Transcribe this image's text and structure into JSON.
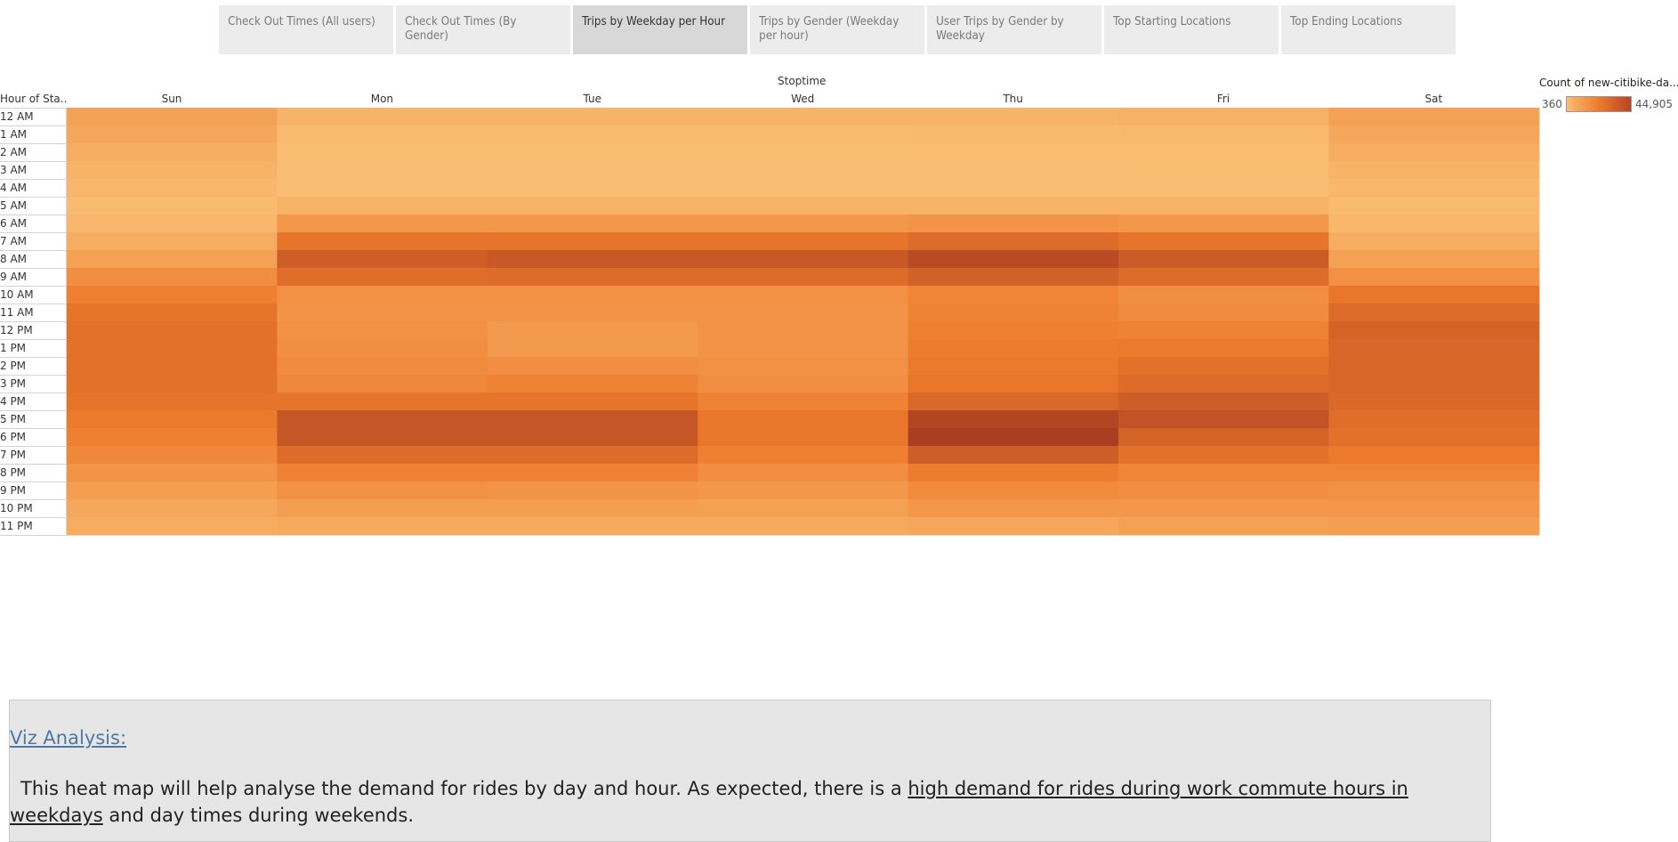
{
  "tabs": [
    {
      "label": "Check Out Times (All users)",
      "active": false
    },
    {
      "label": "Check Out Times (By Gender)",
      "active": false
    },
    {
      "label": "Trips by Weekday per Hour",
      "active": true
    },
    {
      "label": "Trips by Gender (Weekday per hour)",
      "active": false
    },
    {
      "label": "User Trips by Gender by Weekday",
      "active": false
    },
    {
      "label": "Top Starting Locations",
      "active": false
    },
    {
      "label": "Top Ending Locations",
      "active": false
    }
  ],
  "chart_data": {
    "type": "heatmap",
    "column_title": "Stoptime",
    "row_title": "Hour of Sta..",
    "columns": [
      "Sun",
      "Mon",
      "Tue",
      "Wed",
      "Thu",
      "Fri",
      "Sat"
    ],
    "rows": [
      "12 AM",
      "1 AM",
      "2 AM",
      "3 AM",
      "4 AM",
      "5 AM",
      "6 AM",
      "7 AM",
      "8 AM",
      "9 AM",
      "10 AM",
      "11 AM",
      "12 PM",
      "1 PM",
      "2 PM",
      "3 PM",
      "4 PM",
      "5 PM",
      "6 PM",
      "7 PM",
      "8 PM",
      "9 PM",
      "10 PM",
      "11 PM"
    ],
    "values": [
      [
        9500,
        3500,
        3500,
        3500,
        4000,
        4500,
        10000
      ],
      [
        7500,
        1500,
        1500,
        1500,
        1800,
        2000,
        7500
      ],
      [
        5500,
        800,
        800,
        800,
        900,
        1000,
        6000
      ],
      [
        4000,
        500,
        500,
        500,
        500,
        600,
        4000
      ],
      [
        2500,
        400,
        400,
        400,
        400,
        400,
        2500
      ],
      [
        1500,
        3500,
        3500,
        3500,
        3500,
        3500,
        1500
      ],
      [
        2500,
        13000,
        13000,
        13000,
        14000,
        13000,
        2800
      ],
      [
        6000,
        25000,
        25000,
        25000,
        28000,
        25000,
        6000
      ],
      [
        10000,
        33000,
        35000,
        35000,
        40000,
        34000,
        10000
      ],
      [
        16000,
        27000,
        28000,
        28000,
        32000,
        28000,
        15000
      ],
      [
        21000,
        15000,
        15000,
        15000,
        19000,
        16000,
        24000
      ],
      [
        25000,
        14000,
        14000,
        14000,
        20000,
        17000,
        28000
      ],
      [
        26000,
        15000,
        12000,
        14000,
        21000,
        20000,
        31000
      ],
      [
        26000,
        16000,
        12000,
        14000,
        22000,
        23000,
        30000
      ],
      [
        26000,
        17000,
        16000,
        15000,
        23000,
        26000,
        30000
      ],
      [
        26000,
        18000,
        20000,
        16000,
        24000,
        28000,
        30000
      ],
      [
        25000,
        25000,
        25000,
        20000,
        29000,
        33000,
        29000
      ],
      [
        23000,
        36000,
        36000,
        24000,
        42000,
        37000,
        27000
      ],
      [
        21000,
        36000,
        36000,
        24000,
        44905,
        31000,
        26000
      ],
      [
        18000,
        28000,
        28000,
        21000,
        33000,
        26000,
        23000
      ],
      [
        14000,
        20000,
        20000,
        16000,
        22000,
        19000,
        19000
      ],
      [
        11000,
        15000,
        14000,
        13000,
        17000,
        16000,
        15000
      ],
      [
        8000,
        11000,
        11000,
        10000,
        13000,
        13000,
        13000
      ],
      [
        6000,
        7000,
        7000,
        7000,
        8000,
        10000,
        11000
      ]
    ],
    "color_min": "#f9be73",
    "color_mid": "#ee7a2c",
    "color_max": "#a93e22",
    "legend": {
      "title": "Count of new-citibike-da...",
      "min_label": "360",
      "max_label": "44,905",
      "min": 360,
      "max": 44905,
      "position": "top-right"
    }
  },
  "analysis": {
    "title": "Viz Analysis:",
    "text_before": "This heat map will help analyse the demand for rides by day and hour. As expected, there is a ",
    "text_highlight": "high demand for rides during work commute hours in weekdays",
    "text_after": " and day times during weekends."
  }
}
